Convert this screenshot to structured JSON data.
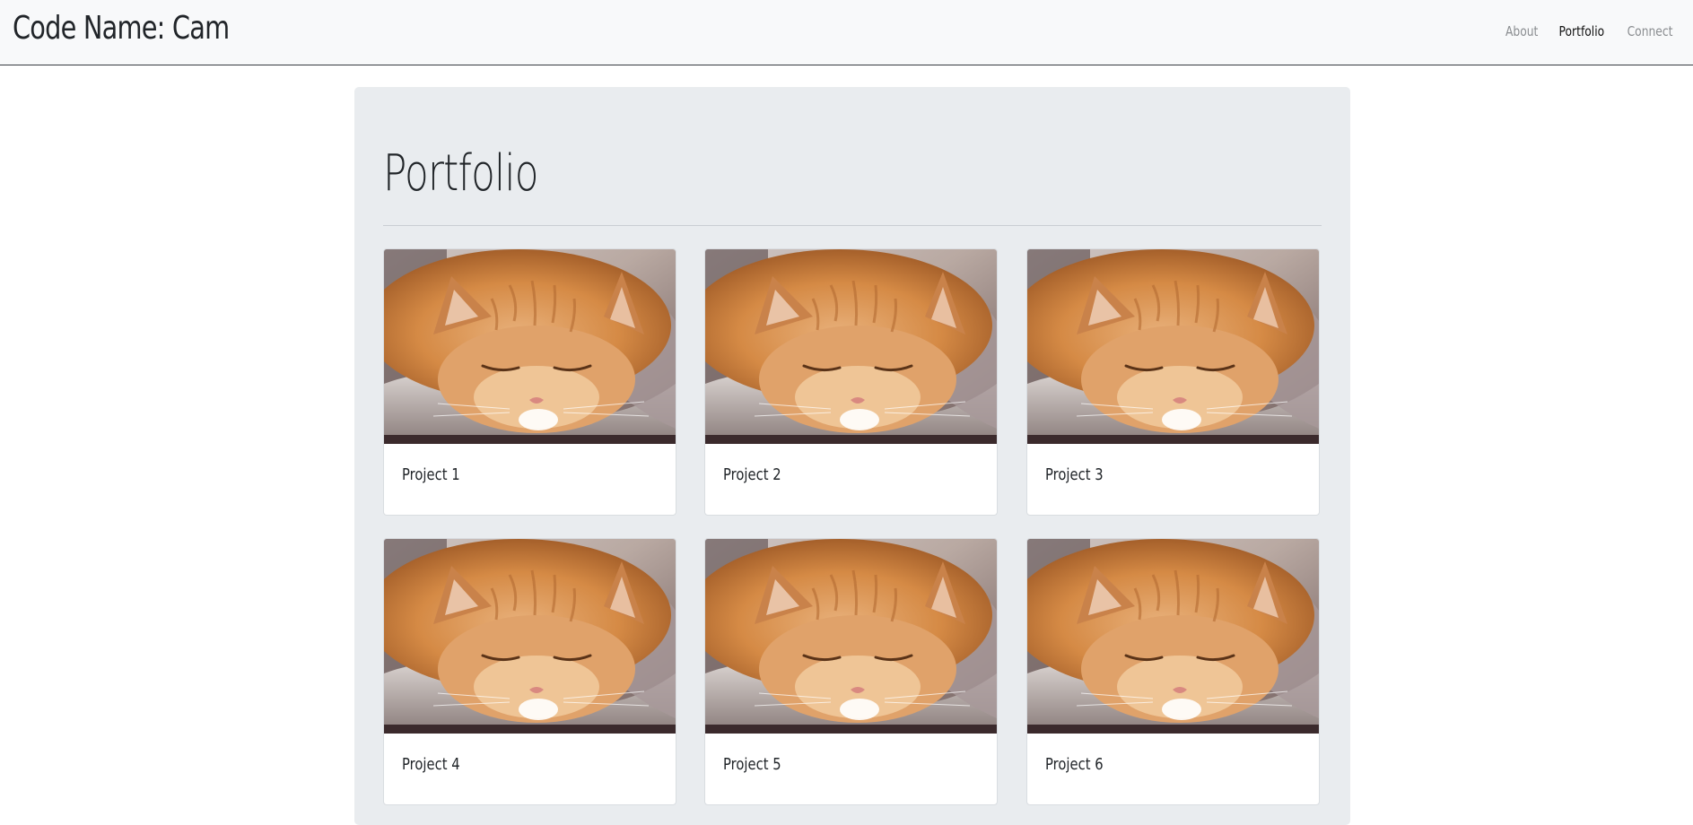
{
  "navbar": {
    "brand": "Code Name: Cam",
    "links": [
      {
        "label": "About",
        "active": false
      },
      {
        "label": "Portfolio",
        "active": true
      },
      {
        "label": "Connect",
        "active": false
      }
    ]
  },
  "main": {
    "title": "Portfolio",
    "cards": [
      {
        "title": "Project 1",
        "image": "sleeping-cat-photo"
      },
      {
        "title": "Project 2",
        "image": "sleeping-cat-photo"
      },
      {
        "title": "Project 3",
        "image": "sleeping-cat-photo"
      },
      {
        "title": "Project 4",
        "image": "sleeping-cat-photo"
      },
      {
        "title": "Project 5",
        "image": "sleeping-cat-photo"
      },
      {
        "title": "Project 6",
        "image": "sleeping-cat-photo"
      }
    ]
  },
  "colors": {
    "navbar_bg": "#f8f9fa",
    "jumbotron_bg": "#e9ecef",
    "text": "#212529",
    "nav_muted": "#8a8d90"
  }
}
